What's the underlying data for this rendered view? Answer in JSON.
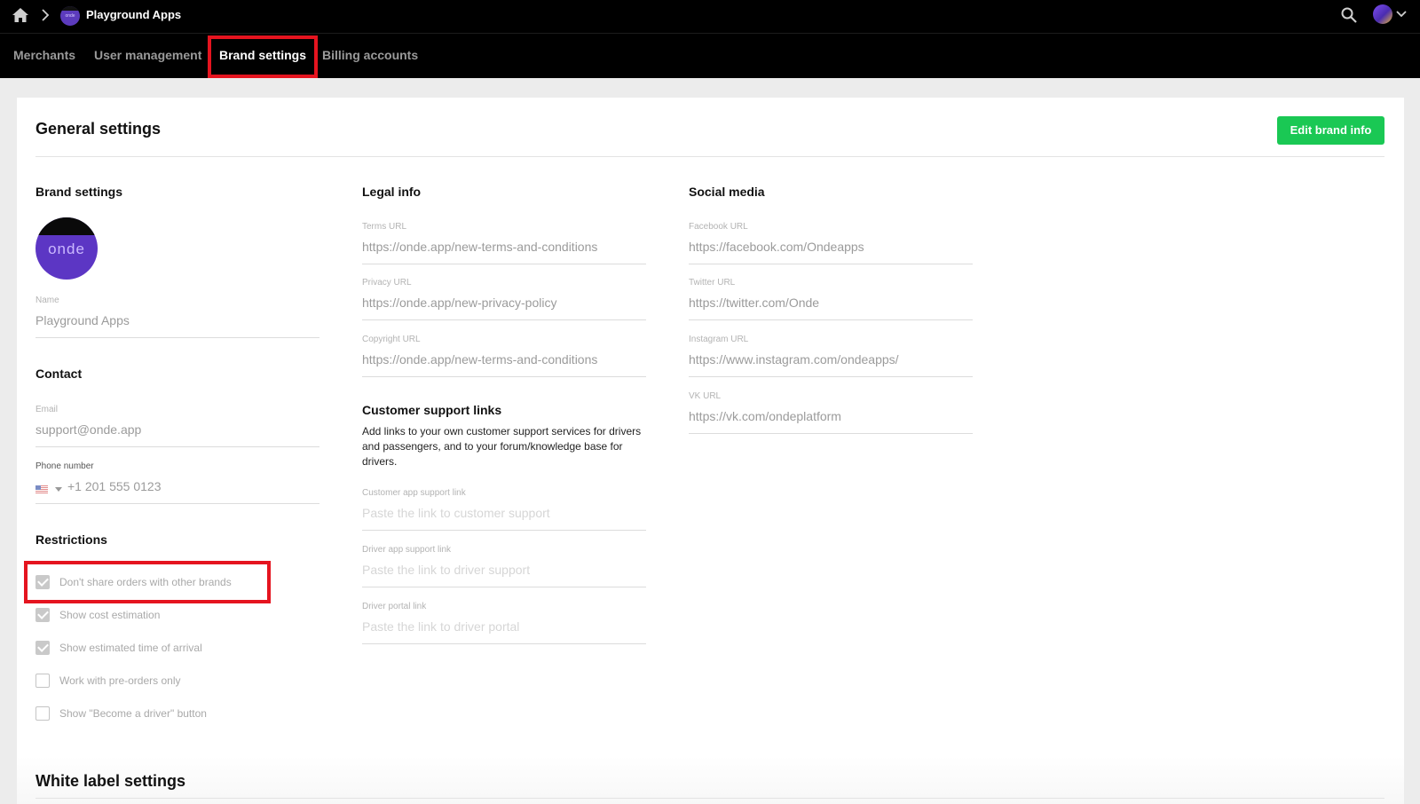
{
  "topbar": {
    "app_name": "Playground Apps",
    "app_logo_text": "onde",
    "icons": [
      "home-icon",
      "chevron-right-icon",
      "search-icon",
      "avatar",
      "chevron-down-icon"
    ]
  },
  "nav": {
    "tabs": [
      {
        "label": "Merchants",
        "active": false
      },
      {
        "label": "User management",
        "active": false
      },
      {
        "label": "Brand settings",
        "active": true
      },
      {
        "label": "Billing accounts",
        "active": false
      }
    ]
  },
  "page": {
    "title": "General settings",
    "edit_button": "Edit brand info",
    "white_label_title": "White label settings"
  },
  "brand": {
    "title": "Brand settings",
    "logo_text": "onde",
    "name_label": "Name",
    "name_value": "Playground Apps"
  },
  "contact": {
    "title": "Contact",
    "email_label": "Email",
    "email_value": "support@onde.app",
    "phone_label": "Phone number",
    "phone_value": "+1 201 555 0123"
  },
  "restrictions": {
    "title": "Restrictions",
    "items": [
      {
        "label": "Don't share orders with other brands",
        "checked": true
      },
      {
        "label": "Show cost estimation",
        "checked": true
      },
      {
        "label": "Show estimated time of arrival",
        "checked": true
      },
      {
        "label": "Work with pre-orders only",
        "checked": false
      },
      {
        "label": "Show \"Become a driver\" button",
        "checked": false
      }
    ]
  },
  "legal": {
    "title": "Legal info",
    "fields": [
      {
        "label": "Terms URL",
        "value": "https://onde.app/new-terms-and-conditions"
      },
      {
        "label": "Privacy URL",
        "value": "https://onde.app/new-privacy-policy"
      },
      {
        "label": "Copyright URL",
        "value": "https://onde.app/new-terms-and-conditions"
      }
    ]
  },
  "support": {
    "title": "Customer support links",
    "description": "Add links to your own customer support services for drivers and passengers, and to your forum/knowledge base for drivers.",
    "fields": [
      {
        "label": "Customer app support link",
        "placeholder": "Paste the link to customer support"
      },
      {
        "label": "Driver app support link",
        "placeholder": "Paste the link to driver support"
      },
      {
        "label": "Driver portal link",
        "placeholder": "Paste the link to driver portal"
      }
    ]
  },
  "social": {
    "title": "Social media",
    "fields": [
      {
        "label": "Facebook URL",
        "value": "https://facebook.com/Ondeapps"
      },
      {
        "label": "Twitter URL",
        "value": "https://twitter.com/Onde"
      },
      {
        "label": "Instagram URL",
        "value": "https://www.instagram.com/ondeapps/"
      },
      {
        "label": "VK URL",
        "value": "https://vk.com/ondeplatform"
      }
    ]
  },
  "colors": {
    "accent_green": "#1ac854",
    "highlight_red": "#e5141f",
    "brand_purple": "#5c36c4"
  }
}
